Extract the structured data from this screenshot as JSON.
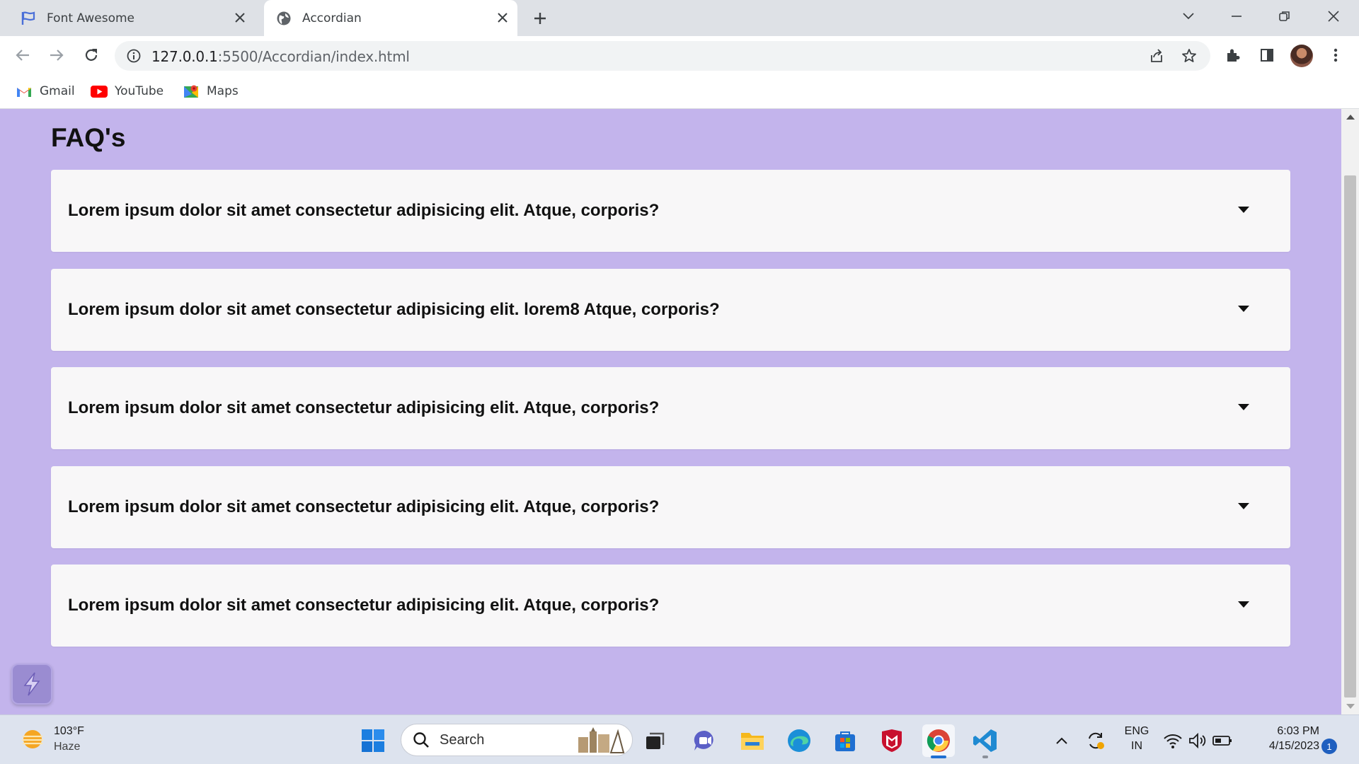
{
  "browser": {
    "tabs": [
      {
        "label": "Font Awesome",
        "active": false
      },
      {
        "label": "Accordian",
        "active": true
      }
    ],
    "url_host": "127.0.0.1",
    "url_path": ":5500/Accordian/index.html",
    "bookmarks": [
      {
        "label": "Gmail",
        "icon": "gmail-icon"
      },
      {
        "label": "YouTube",
        "icon": "youtube-icon"
      },
      {
        "label": "Maps",
        "icon": "maps-icon"
      }
    ]
  },
  "page": {
    "title": "FAQ's",
    "background": "#c3b4ec",
    "faqs": [
      {
        "question": "Lorem ipsum dolor sit amet consectetur adipisicing elit. Atque, corporis?"
      },
      {
        "question": "Lorem ipsum dolor sit amet consectetur adipisicing elit. lorem8 Atque, corporis?"
      },
      {
        "question": "Lorem ipsum dolor sit amet consectetur adipisicing elit. Atque, corporis?"
      },
      {
        "question": "Lorem ipsum dolor sit amet consectetur adipisicing elit. Atque, corporis?"
      },
      {
        "question": "Lorem ipsum dolor sit amet consectetur adipisicing elit. Atque, corporis?"
      }
    ]
  },
  "taskbar": {
    "weather_temp": "103°F",
    "weather_desc": "Haze",
    "search_label": "Search",
    "lang_top": "ENG",
    "lang_bottom": "IN",
    "time": "6:03 PM",
    "date": "4/15/2023",
    "notification_count": "1"
  }
}
